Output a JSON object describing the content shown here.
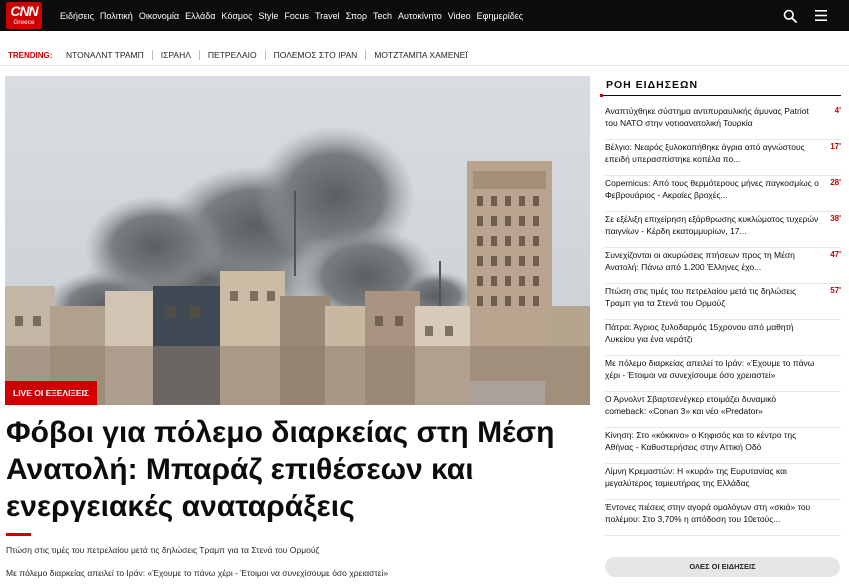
{
  "header": {
    "logo_text": "CNN",
    "logo_sub": "Greece",
    "nav": [
      "Ειδήσεις",
      "Πολιτική",
      "Οικονομία",
      "Ελλάδα",
      "Κόσμος",
      "Style",
      "Focus",
      "Travel",
      "Σπορ",
      "Tech",
      "Αυτοκίνητο",
      "Video",
      "Εφημερίδες"
    ]
  },
  "trending": {
    "label": "TRENDING:",
    "items": [
      "ΝΤΟΝΑΛΝΤ ΤΡΑΜΠ",
      "ΙΣΡΑΗΛ",
      "ΠΕΤΡΕΛΑΙΟ",
      "ΠΟΛΕΜΟΣ ΣΤΟ ΙΡΑΝ",
      "ΜΟΤΖΤΑΜΠΑ ΧΑΜΕΝΕΪ"
    ]
  },
  "hero": {
    "badge": "LIVE ΟΙ ΕΞΕΛΙΞΕΙΣ",
    "headline": "Φόβοι για πόλεμο διαρκείας στη Μέση Ανατολή: Μπαράζ επιθέσεων και ενεργειακές αναταράξεις",
    "subs": [
      "Πτώση στις τιμές του πετρελαίου μετά τις δηλώσεις Τραμπ για τα Στενά του Ορμούζ",
      "Με πόλεμο διαρκείας απειλεί το Ιράν: «Έχουμε το πάνω χέρι - Έτοιμοι να συνεχίσουμε όσο χρειαστεί»"
    ]
  },
  "feed": {
    "title": "ΡΟΗ ΕΙΔΗΣΕΩΝ",
    "items": [
      {
        "text": "Αναπτύχθηκε σύστημα αντιπυραυλικής άμυνας Patriot του ΝΑΤΟ στην νοτιοανατολική Τουρκία",
        "mins": "4'"
      },
      {
        "text": "Βέλγιο: Νεαρός ξυλοκοπήθηκε άγρια από αγνώστους επειδή υπερασπίστηκε κοπέλα πο...",
        "mins": "17'"
      },
      {
        "text": "Copernicus: Από τους θερμότερους μήνες παγκοσμίως ο Φεβρουάριος - Ακραίες βροχές...",
        "mins": "28'"
      },
      {
        "text": "Σε εξέλιξη επιχείρηση εξάρθρωσης κυκλώματος τυχερών παιγνίων - Κέρδη εκατομμυρίων, 17...",
        "mins": "38'"
      },
      {
        "text": "Συνεχίζονται οι ακυρώσεις πτήσεων προς τη Μέση Ανατολή: Πάνω από 1.200 Έλληνες έχο...",
        "mins": "47'"
      },
      {
        "text": "Πτώση στις τιμές του πετρελαίου μετά τις δηλώσεις Τραμπ για τα Στενά του Ορμούζ",
        "mins": "57'"
      },
      {
        "text": "Πάτρα: Άγριος ξυλοδαρμός 15χρονου από μαθητή Λυκείου για ένα νεράτζι",
        "mins": ""
      },
      {
        "text": "Με πόλεμο διαρκείας απειλεί το Ιράν: «Έχουμε το πάνω χέρι - Έτοιμοι να συνεχίσουμε όσο χρειαστεί»",
        "mins": ""
      },
      {
        "text": "Ο Άρνολντ Σβαρτσενέγκερ ετοιμάζει δυναμικό comeback: «Conan 3» και νέο «Predator»",
        "mins": ""
      },
      {
        "text": "Κίνηση: Στο «κόκκινο» ο Κηφισός και το κέντρο της Αθήνας - Καθυστερήσεις στην Αττική Οδό",
        "mins": ""
      },
      {
        "text": "Λίμνη Κρεμαστών: Η «κυρά» της Ευρυτανίας και μεγαλύτερος ταμιευτήρας της Ελλάδας",
        "mins": ""
      },
      {
        "text": "Έντονες πιέσεις στην αγορά ομολόγων στη «σκιά» του πολέμου: Στο 3,70% η απόδοση του 10ετούς...",
        "mins": ""
      }
    ],
    "all_button": "ΟΛΕΣ ΟΙ ΕΙΔΗΣΕΙΣ"
  }
}
